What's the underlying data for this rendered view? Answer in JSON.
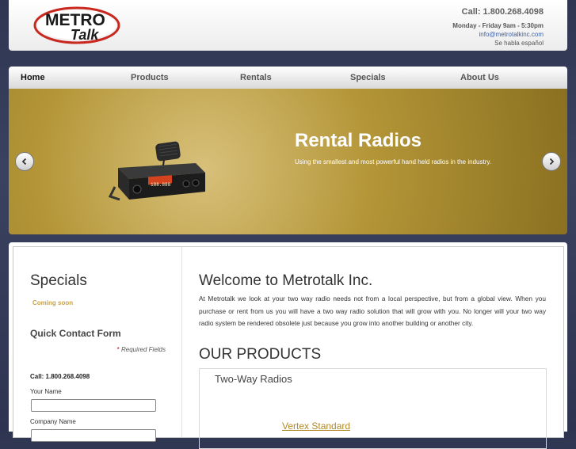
{
  "header": {
    "logo": {
      "top": "METRO",
      "bottom": "Talk"
    },
    "call": "Call: 1.800.268.4098",
    "hours": "Monday - Friday 9am - 5:30pm",
    "email": "info@metrotalkinc.com",
    "espanol": "Se habla español"
  },
  "nav": {
    "items": [
      {
        "label": "Home"
      },
      {
        "label": "Products"
      },
      {
        "label": "Rentals"
      },
      {
        "label": "Specials"
      },
      {
        "label": "About Us"
      }
    ]
  },
  "banner": {
    "title": "Rental Radios",
    "subtitle": "Using the smallest and most powerful hand held radios in the industry.",
    "radio_display": "188.888"
  },
  "sidebar": {
    "specials_title": "Specials",
    "coming_soon": "Coming soon",
    "quick_contact_title": "Quick Contact Form",
    "required_star": "*",
    "required_text": "Required Fields",
    "call": "Call: 1.800.268.4098",
    "name_label": "Your Name",
    "name_value": "",
    "company_label": "Company Name",
    "company_value": ""
  },
  "main": {
    "welcome_title": "Welcome to Metrotalk Inc.",
    "intro": "At Metrotalk we look at your two way radio needs not from a local perspective, but from a global view. When you purchase or rent  from us you will have a  two way radio solution that will grow with you. No longer will your two way radio system be rendered obsolete just because you grow into another building or another city.",
    "products_title": "OUR PRODUCTS",
    "product_heading": "Two-Way Radios",
    "product_link": "Vertex Standard"
  },
  "colors": {
    "accent_gold": "#b08a2a",
    "logo_red": "#c8281e",
    "link_blue": "#3c5fa6"
  }
}
